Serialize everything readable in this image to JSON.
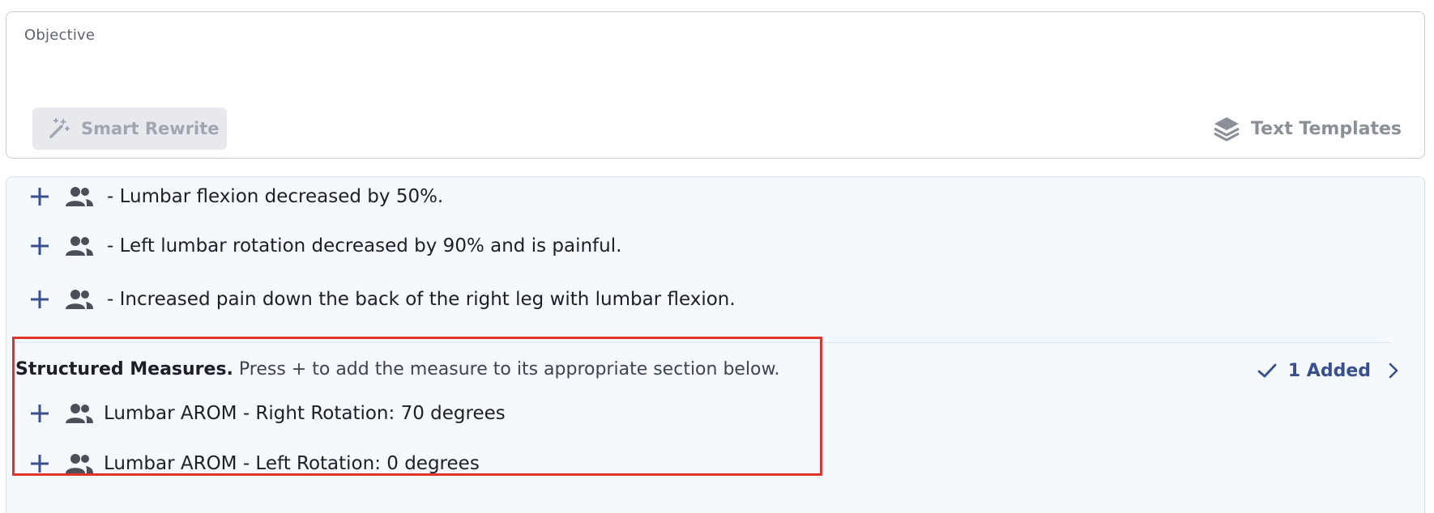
{
  "objective": {
    "label": "Objective",
    "smart_rewrite_label": "Smart Rewrite",
    "text_templates_label": "Text Templates"
  },
  "suggestions": {
    "items": [
      {
        "text": "- Lumbar flexion decreased by 50%."
      },
      {
        "text": "- Left lumbar rotation decreased by 90% and is painful."
      },
      {
        "text": "- Increased pain down the back of the right leg with lumbar flexion."
      }
    ]
  },
  "structured_measures": {
    "title": "Structured Measures.",
    "instruction": " Press + to add the measure to its appropriate section below.",
    "added_label": "1 Added",
    "items": [
      {
        "text": "Lumbar AROM - Right Rotation: 70 degrees"
      },
      {
        "text": "Lumbar AROM - Left Rotation: 0 degrees"
      }
    ]
  },
  "colors": {
    "accent": "#3a4f8f",
    "highlight_border": "#e0342a",
    "panel_bg": "#f4f9fd"
  },
  "icons": [
    "magic-wand-icon",
    "layers-icon",
    "plus-icon",
    "people-icon",
    "check-icon",
    "chevron-right-icon"
  ]
}
